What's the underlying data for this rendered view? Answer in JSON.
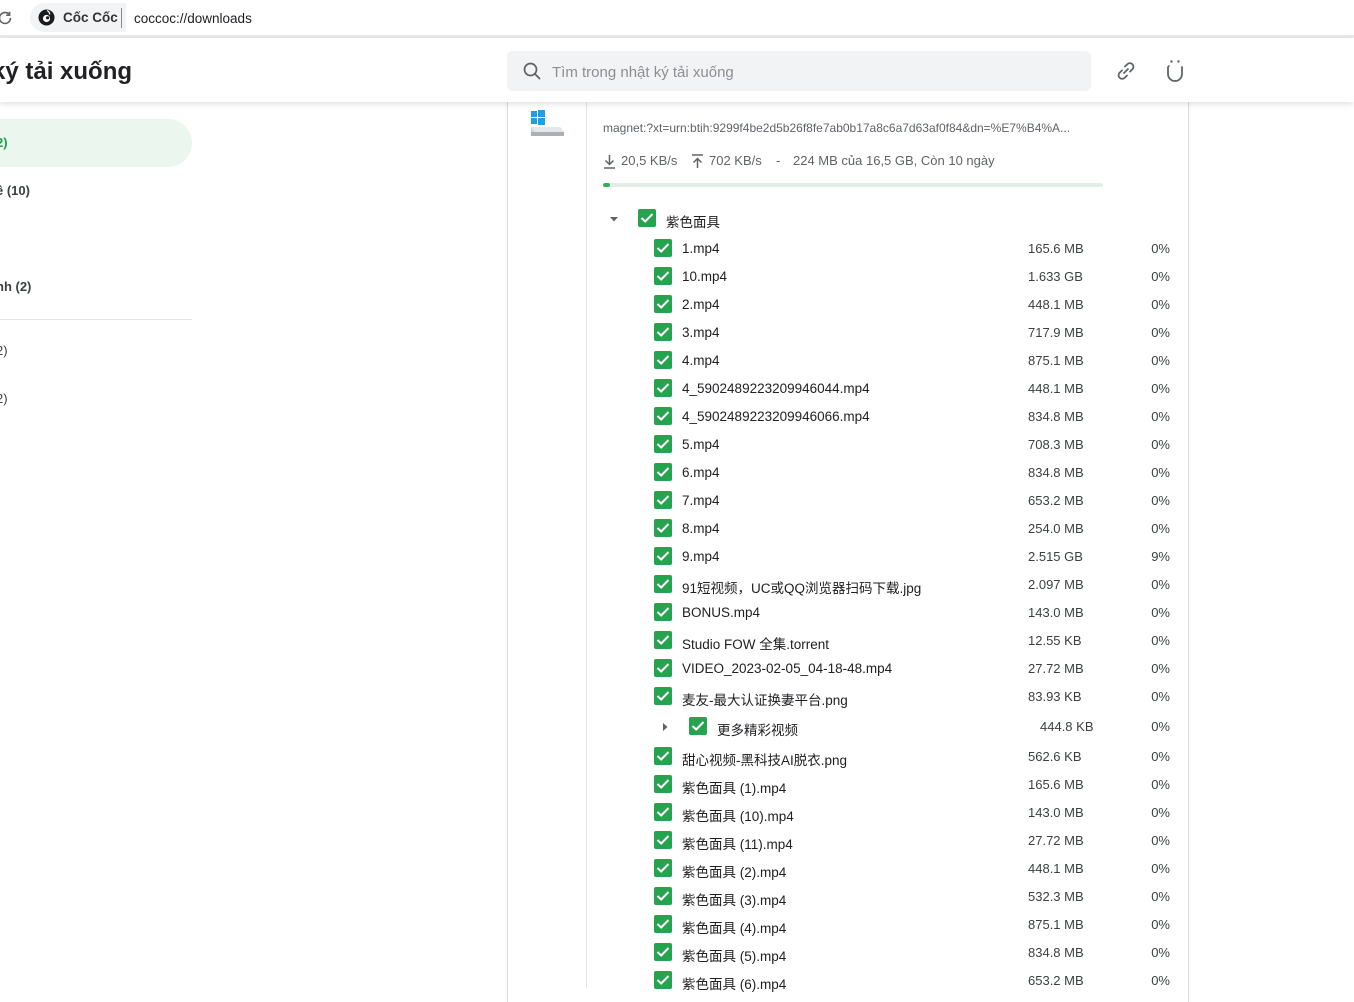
{
  "browser": {
    "brand_name": "Cốc Cốc",
    "url": "coccoc://downloads"
  },
  "header": {
    "title": "ký tải xuống",
    "search_placeholder": "Tìm trong nhật ký tải xuống"
  },
  "sidebar": {
    "items": [
      {
        "label": "2)",
        "active": true
      },
      {
        "label": "ề (10)",
        "bold": true
      },
      {
        "label": "nh (2)",
        "bold": false
      },
      {
        "label": "2)",
        "bold": false
      },
      {
        "label": "2)",
        "bold": false
      }
    ]
  },
  "download": {
    "magnet": "magnet:?xt=urn:btih:9299f4be2d5b26f8fe7ab0b17a8c6a7d63af0f84&dn=%E7%B4%A...",
    "download_speed": "20,5 KB/s",
    "upload_speed": "702 KB/s",
    "separator": "-",
    "progress_text": "224 MB của 16,5 GB, Còn 10 ngày",
    "progress_fraction": 0.0136,
    "root_folder": "紫色面具",
    "files": [
      {
        "name": "1.mp4",
        "size": "165.6 MB",
        "percent": "0%"
      },
      {
        "name": "10.mp4",
        "size": "1.633 GB",
        "percent": "0%"
      },
      {
        "name": "2.mp4",
        "size": "448.1 MB",
        "percent": "0%"
      },
      {
        "name": "3.mp4",
        "size": "717.9 MB",
        "percent": "0%"
      },
      {
        "name": "4.mp4",
        "size": "875.1 MB",
        "percent": "0%"
      },
      {
        "name": "4_5902489223209946044.mp4",
        "size": "448.1 MB",
        "percent": "0%"
      },
      {
        "name": "4_5902489223209946066.mp4",
        "size": "834.8 MB",
        "percent": "0%"
      },
      {
        "name": "5.mp4",
        "size": "708.3 MB",
        "percent": "0%"
      },
      {
        "name": "6.mp4",
        "size": "834.8 MB",
        "percent": "0%"
      },
      {
        "name": "7.mp4",
        "size": "653.2 MB",
        "percent": "0%"
      },
      {
        "name": "8.mp4",
        "size": "254.0 MB",
        "percent": "0%"
      },
      {
        "name": "9.mp4",
        "size": "2.515 GB",
        "percent": "9%"
      },
      {
        "name": "91短视频，UC或QQ浏览器扫码下载.jpg",
        "size": "2.097 MB",
        "percent": "0%"
      },
      {
        "name": "BONUS.mp4",
        "size": "143.0 MB",
        "percent": "0%"
      },
      {
        "name": "Studio FOW 全集.torrent",
        "size": "12.55 KB",
        "percent": "0%"
      },
      {
        "name": "VIDEO_2023-02-05_04-18-48.mp4",
        "size": "27.72 MB",
        "percent": "0%"
      },
      {
        "name": "麦友-最大认证换妻平台.png",
        "size": "83.93 KB",
        "percent": "0%"
      },
      {
        "name": "更多精彩视频",
        "size": "444.8 KB",
        "percent": "0%",
        "folder": true
      },
      {
        "name": "甜心视频-黑科技AI脱衣.png",
        "size": "562.6 KB",
        "percent": "0%"
      },
      {
        "name": "紫色面具 (1).mp4",
        "size": "165.6 MB",
        "percent": "0%"
      },
      {
        "name": "紫色面具 (10).mp4",
        "size": "143.0 MB",
        "percent": "0%"
      },
      {
        "name": "紫色面具 (11).mp4",
        "size": "27.72 MB",
        "percent": "0%"
      },
      {
        "name": "紫色面具 (2).mp4",
        "size": "448.1 MB",
        "percent": "0%"
      },
      {
        "name": "紫色面具 (3).mp4",
        "size": "532.3 MB",
        "percent": "0%"
      },
      {
        "name": "紫色面具 (4).mp4",
        "size": "875.1 MB",
        "percent": "0%"
      },
      {
        "name": "紫色面具 (5).mp4",
        "size": "834.8 MB",
        "percent": "0%"
      },
      {
        "name": "紫色面具 (6).mp4",
        "size": "653.2 MB",
        "percent": "0%"
      }
    ]
  },
  "colors": {
    "accent_green": "#27a24e",
    "sidebar_active_bg": "#ebf6ee",
    "progress_fill": "#2fb35a"
  },
  "icons": {
    "reload": "reload-icon",
    "brand": "coccoc-logo-icon",
    "search": "search-icon",
    "link": "link-icon",
    "shutdown": "power-icon",
    "file_type": "windows-drive-icon",
    "check": "checkmark-icon",
    "expand": "caret-icon"
  }
}
